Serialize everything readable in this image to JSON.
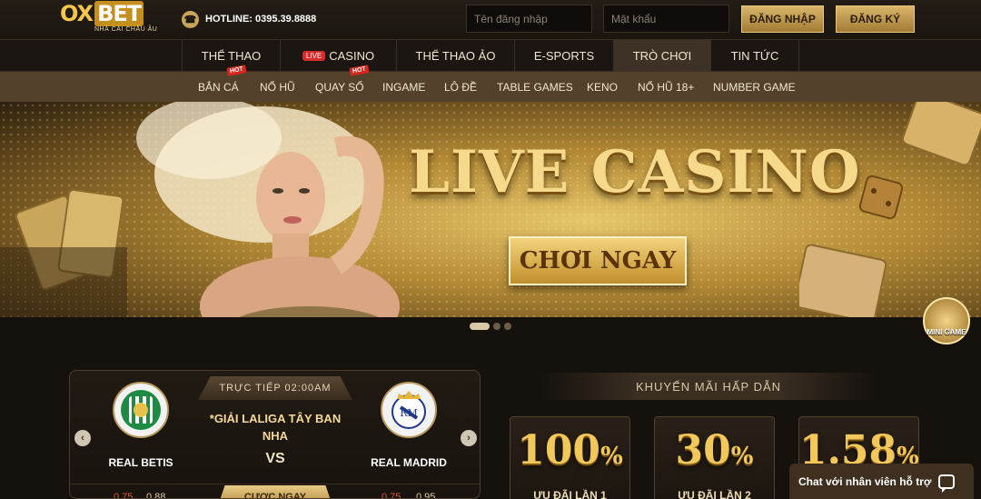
{
  "header": {
    "logo_main_left": "OX",
    "logo_main_right": "BET",
    "logo_sub": "NHÀ CÁI CHÂU ÂU",
    "hotline": "HOTLINE: 0395.39.8888",
    "username_placeholder": "Tên đăng nhập",
    "password_placeholder": "Mật khẩu",
    "login_label": "ĐĂNG NHẬP",
    "register_label": "ĐĂNG KÝ"
  },
  "nav": {
    "items": [
      {
        "label": "THỂ THAO"
      },
      {
        "label": "CASINO",
        "badge": "LIVE"
      },
      {
        "label": "THỂ THAO ẢO"
      },
      {
        "label": "E-SPORTS"
      },
      {
        "label": "TRÒ CHƠI",
        "active": true
      },
      {
        "label": "TIN TỨC"
      }
    ]
  },
  "subnav": {
    "items": [
      {
        "label": "BẮN CÁ",
        "badge": "HOT"
      },
      {
        "label": "NỔ HŨ"
      },
      {
        "label": "QUAY SỐ",
        "badge": "HOT"
      },
      {
        "label": "INGAME"
      },
      {
        "label": "LÔ ĐỀ"
      },
      {
        "label": "TABLE GAMES"
      },
      {
        "label": "KENO"
      },
      {
        "label": "NỔ HŨ 18+"
      },
      {
        "label": "NUMBER GAME"
      }
    ]
  },
  "banner": {
    "title": "LIVE CASINO",
    "cta": "CHƠI NGAY",
    "slide_count": 3,
    "active_slide": 1
  },
  "minigame": {
    "label": "MINI GAME"
  },
  "match": {
    "live_label": "TRỰC TIẾP 02:00AM",
    "league": "*GIẢI LALIGA TÂY BAN NHA",
    "vs": "VS",
    "home": {
      "name": "REAL BETIS",
      "odds_a": "0.75",
      "odds_b": "0.88"
    },
    "away": {
      "name": "REAL MADRID",
      "odds_a": "0.75",
      "odds_b": "0.95"
    },
    "bet_label": "CƯỢC NGAY"
  },
  "promotions": {
    "title": "KHUYẾN MÃI HẤP DẪN",
    "cards": [
      {
        "value": "100",
        "unit": "%",
        "label": "ƯU ĐÃI LẦN 1"
      },
      {
        "value": "30",
        "unit": "%",
        "label": "ƯU ĐÃI LẦN 2"
      },
      {
        "value": "1.58",
        "unit": "%",
        "label": ""
      }
    ]
  },
  "chat": {
    "label": "Chat với nhân viên hỗ trợ"
  },
  "colors": {
    "gold": "#d9b56a",
    "dark_bg": "#15110d",
    "live_red": "#d92b2b"
  }
}
